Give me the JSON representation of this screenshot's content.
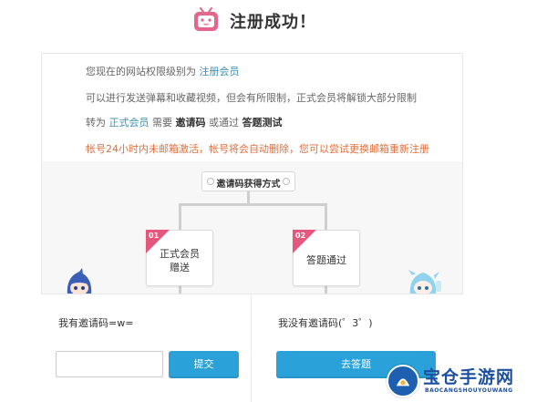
{
  "header": {
    "title": "注册成功！"
  },
  "info": {
    "line1_prefix": "您现在的网站权限级别为",
    "line1_level": "注册会员",
    "line2": "可以进行发送弹幕和收藏视频，但会有所限制，正式会员将解锁大部分限制",
    "line3_prefix": "转为",
    "line3_member": "正式会员",
    "line3_need": "需要",
    "line3_code": "邀请码",
    "line3_or": "或通过",
    "line3_quiz": "答题测试",
    "line4_warning": "帐号24小时内未邮箱激活，帐号将会自动删除，您可以尝试更换邮箱重新注册"
  },
  "methods": {
    "title": "邀请码获得方式",
    "options": [
      {
        "num": "01",
        "label_line1": "正式会员",
        "label_line2": "赠送"
      },
      {
        "num": "02",
        "label_line1": "答题通过",
        "label_line2": ""
      }
    ]
  },
  "panels": {
    "left_label": "我有邀请码=w=",
    "code_input_value": "",
    "submit_label": "提交",
    "right_label": "我没有邀请码(゜3゜)",
    "answer_label": "去答题"
  },
  "watermark": {
    "brand": "宝仓手游网",
    "sub": "BAOCANGSHOUYOUWANG"
  },
  "colors": {
    "accent_blue": "#2aa1d8",
    "link_blue": "#3a8fb7",
    "warning_orange": "#e06f3c",
    "tag_pink": "#e5577d"
  }
}
